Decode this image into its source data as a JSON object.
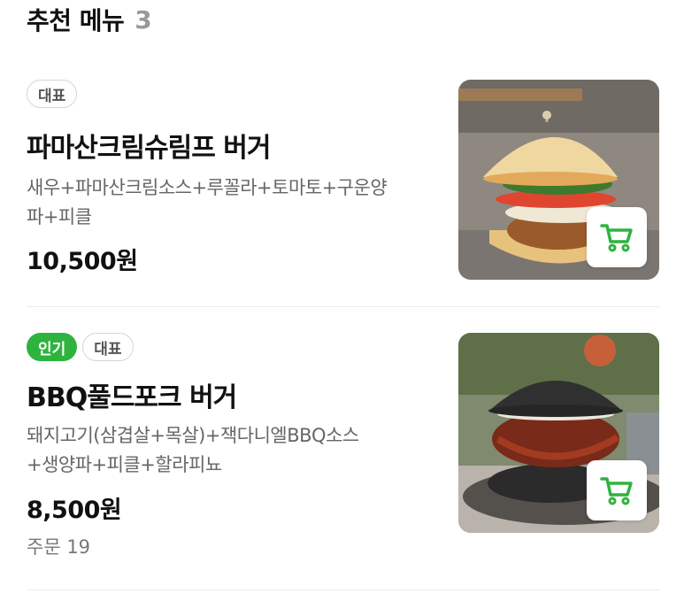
{
  "section": {
    "title": "추천 메뉴",
    "count": "3"
  },
  "items": [
    {
      "badges": [
        "대표"
      ],
      "name": "파마산크림슈림프 버거",
      "desc_line1": "새우+파마산크림소스+루꼴라+토마토+구운양",
      "desc_line2": "파+피클",
      "price": "10,500원",
      "image": "shrimp-burger-photo",
      "cart_icon": "cart-icon"
    },
    {
      "badges": [
        "인기",
        "대표"
      ],
      "name": "BBQ풀드포크 버거",
      "desc_line1": "돼지고기(삼겹살+목살)+잭다니엘BBQ소스",
      "desc_line2": "+생양파+피클+할라피뇨",
      "price": "8,500원",
      "orders": "주문 19",
      "image": "pulled-pork-burger-photo",
      "cart_icon": "cart-icon"
    }
  ],
  "colors": {
    "accent": "#2fb33f",
    "muted": "#9a9a9a"
  }
}
